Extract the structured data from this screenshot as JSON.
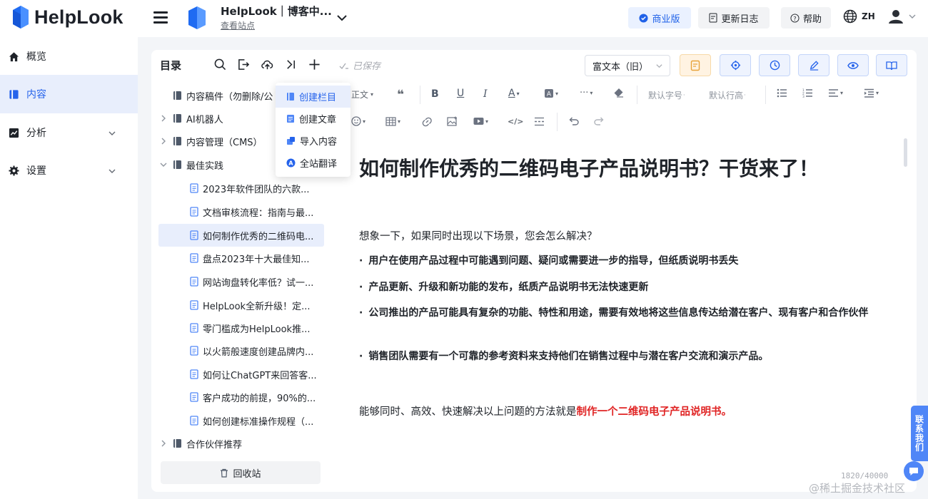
{
  "header": {
    "logo_text": "HelpLook",
    "site_name": "HelpLook｜博客中...",
    "site_link": "查看站点",
    "business_label": "商业版",
    "changelog_label": "更新日志",
    "help_label": "帮助",
    "lang_label": "ZH"
  },
  "nav": {
    "items": [
      {
        "label": "概览"
      },
      {
        "label": "内容"
      },
      {
        "label": "分析"
      },
      {
        "label": "设置"
      }
    ]
  },
  "tree": {
    "title": "目录",
    "rows": [
      {
        "label": "内容稿件（勿删除/公",
        "kind": "book"
      },
      {
        "label": "AI机器人",
        "kind": "book"
      },
      {
        "label": "内容管理（CMS）",
        "kind": "book"
      },
      {
        "label": "最佳实践",
        "kind": "book"
      },
      {
        "label": "2023年软件团队的六款...",
        "kind": "doc"
      },
      {
        "label": "文档审核流程：指南与最...",
        "kind": "doc"
      },
      {
        "label": "如何制作优秀的二维码电...",
        "kind": "doc"
      },
      {
        "label": "盘点2023年十大最佳知...",
        "kind": "doc"
      },
      {
        "label": "网站询盘转化率低？试一...",
        "kind": "doc"
      },
      {
        "label": "HelpLook全新升级！定...",
        "kind": "doc"
      },
      {
        "label": "零门槛成为HelpLook推...",
        "kind": "doc"
      },
      {
        "label": "以火箭般速度创建品牌内...",
        "kind": "doc"
      },
      {
        "label": "如何让ChatGPT来回答客...",
        "kind": "doc"
      },
      {
        "label": "客户成功的前提，90%的...",
        "kind": "doc"
      },
      {
        "label": "如何创建标准操作规程（...",
        "kind": "doc"
      },
      {
        "label": "合作伙伴推荐",
        "kind": "book"
      }
    ],
    "trash_label": "回收站"
  },
  "menu": {
    "items": [
      {
        "label": "创建栏目"
      },
      {
        "label": "创建文章"
      },
      {
        "label": "导入内容"
      },
      {
        "label": "全站翻译"
      }
    ]
  },
  "editor": {
    "saved_label": "已保存",
    "mode_label": "富文本（旧）",
    "toolbar": {
      "paragraph": "正文",
      "font_size": "默认字号",
      "line_height": "默认行高"
    },
    "title": "如何制作优秀的二维码电子产品说明书？干货来了！",
    "intro": "想象一下，如果同时出现以下场景，您会怎么解决？",
    "bullets": [
      "用户在使用产品过程中可能遇到问题、疑问或需要进一步的指导，但纸质说明书丢失",
      "产品更新、升级和新功能的发布，纸质产品说明书无法快速更新",
      "公司推出的产品可能具有复杂的功能、特性和用途，需要有效地将这些信息传达给潜在客户、现有客户和合作伙伴",
      "销售团队需要有一个可靠的参考资料来支持他们在销售过程中与潜在客户交流和演示产品。"
    ],
    "conclusion_prefix": "能够同时、高效、快速解决以上问题的方法就是",
    "conclusion_highlight": "制作一个二维码电子产品说明书。",
    "counter": "1820/40000"
  },
  "feedback_label": "联系我们",
  "watermark": "@稀土掘金技术社区",
  "colors": {
    "accent": "#2563eb",
    "active_bg": "#e8eefc",
    "highlight_red": "#e02424",
    "logo_blue": "#1f6bf2"
  }
}
